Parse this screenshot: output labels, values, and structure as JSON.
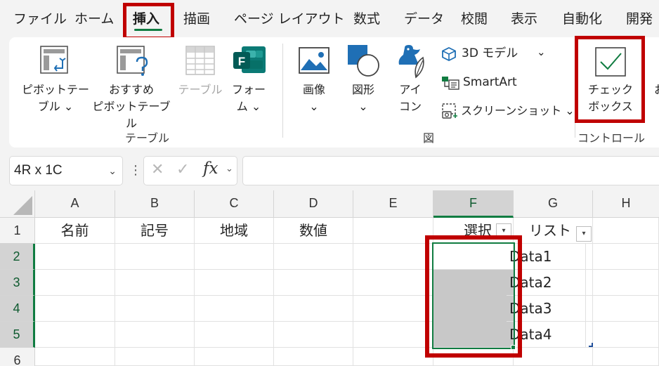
{
  "menu": {
    "tabs": [
      "ファイル",
      "ホーム",
      "挿入",
      "描画",
      "ページ レイアウト",
      "数式",
      "データ",
      "校閲",
      "表示",
      "自動化",
      "開発"
    ]
  },
  "ribbon": {
    "pivot_table": [
      "ピボットテー",
      "ブル ⌄"
    ],
    "recommended_pivot": [
      "おすすめ",
      "ピボットテーブル"
    ],
    "table": [
      "テーブル"
    ],
    "forms": [
      "フォー",
      "ム ⌄"
    ],
    "group_table": "テーブル",
    "image": [
      "画像",
      "⌄"
    ],
    "shapes": [
      "図形",
      "⌄"
    ],
    "icons": [
      "アイ",
      "コン"
    ],
    "model3d": "3D モデル",
    "model3d_chevron": "⌄",
    "smartart": "SmartArt",
    "screenshot": "スクリーンショット ⌄",
    "group_illustrations": "図",
    "checkbox": [
      "チェック",
      "ボックス"
    ],
    "group_controls": "コントロール",
    "cut_char": "お"
  },
  "formula_bar": {
    "name_box": "4R x 1C",
    "name_box_chevron": "⌄",
    "cancel": "✕",
    "enter": "✓",
    "fx": "fx",
    "more": "⋮"
  },
  "sheet": {
    "columns": [
      "A",
      "B",
      "C",
      "D",
      "E",
      "F",
      "G",
      "H"
    ],
    "rows": [
      "1",
      "2",
      "3",
      "4",
      "5",
      "6"
    ],
    "headers": {
      "A1": "名前",
      "B1": "記号",
      "C1": "地域",
      "D1": "数値",
      "F1": "選択",
      "G1": "リスト"
    },
    "g_values": [
      "Data1",
      "Data2",
      "Data3",
      "Data4"
    ],
    "filter_icon": "▾"
  },
  "colors": {
    "accent": "#107c41",
    "highlight": "#c00000"
  }
}
